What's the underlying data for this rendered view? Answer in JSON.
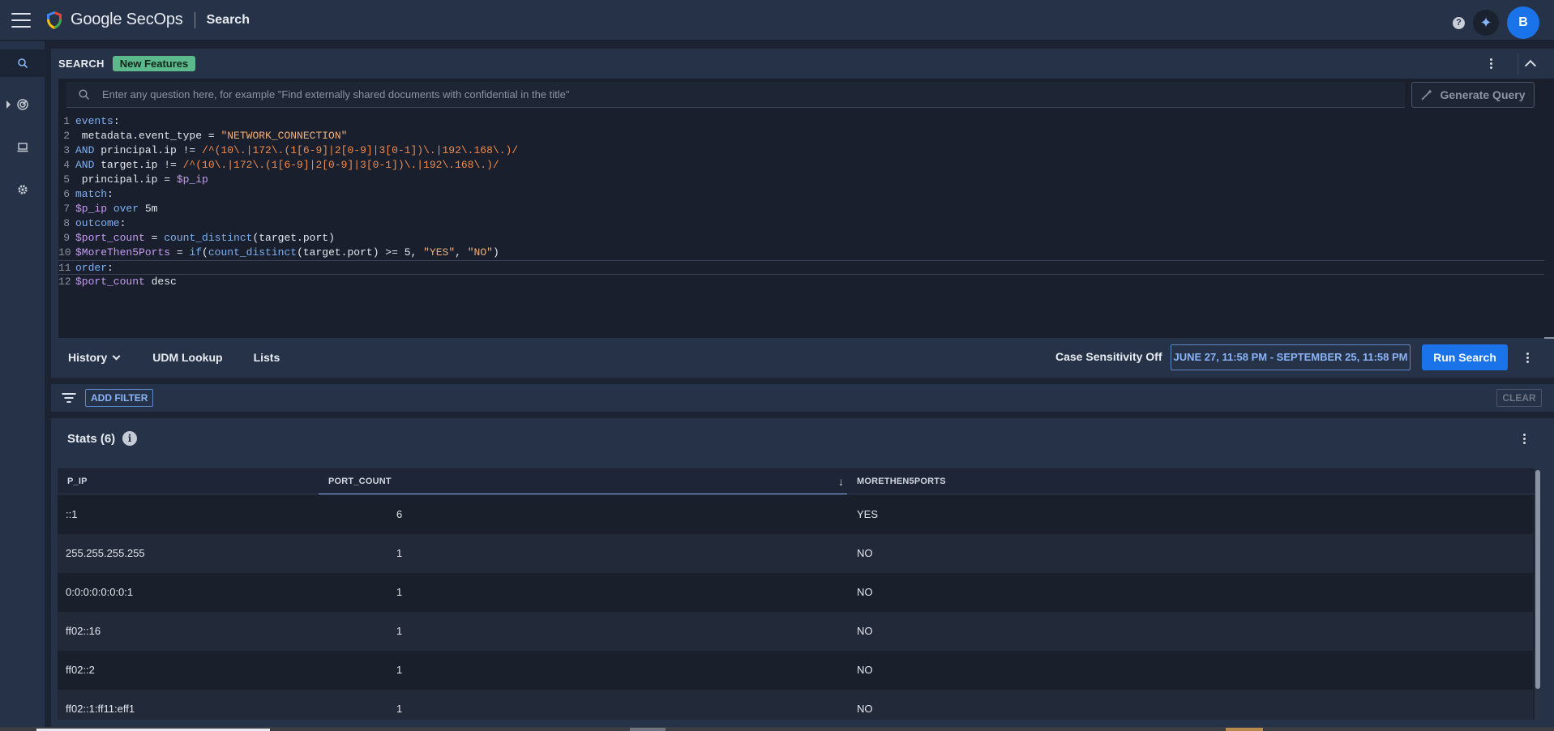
{
  "header": {
    "brand": "Google SecOps",
    "page_name": "Search",
    "help_icon": "help-icon",
    "gemini_icon": "sparkle-icon",
    "avatar_initial": "B"
  },
  "rail": {
    "items": [
      {
        "icon": "search-icon"
      },
      {
        "icon": "radar-icon"
      },
      {
        "icon": "laptop-icon"
      },
      {
        "icon": "gear-icon"
      }
    ]
  },
  "search_panel": {
    "title": "SEARCH",
    "badge": "New Features",
    "nl_placeholder": "Enter any question here, for example \"Find externally shared documents with confidential in the title\"",
    "generate_label": "Generate Query",
    "code_lines": [
      {
        "n": "1",
        "parts": [
          [
            "kw",
            "events"
          ],
          [
            "tx",
            ":"
          ]
        ]
      },
      {
        "n": "2",
        "parts": [
          [
            "tx",
            " metadata.event_type = "
          ],
          [
            "str",
            "\"NETWORK_CONNECTION\""
          ]
        ]
      },
      {
        "n": "3",
        "parts": [
          [
            "kw",
            "AND"
          ],
          [
            "tx",
            " principal.ip != "
          ],
          [
            "rx",
            "/^(10\\.|172\\.(1[6-9]|2[0-9]|3[0-1])\\.|192\\.168\\.)/"
          ]
        ]
      },
      {
        "n": "4",
        "parts": [
          [
            "kw",
            "AND"
          ],
          [
            "tx",
            " target.ip != "
          ],
          [
            "rx",
            "/^(10\\.|172\\.(1[6-9]|2[0-9]|3[0-1])\\.|192\\.168\\.)/"
          ]
        ]
      },
      {
        "n": "5",
        "parts": [
          [
            "tx",
            " principal.ip = "
          ],
          [
            "var",
            "$p_ip"
          ]
        ]
      },
      {
        "n": "6",
        "parts": [
          [
            "kw",
            "match"
          ],
          [
            "tx",
            ":"
          ]
        ]
      },
      {
        "n": "7",
        "parts": [
          [
            "var",
            "$p_ip"
          ],
          [
            "kw",
            " over"
          ],
          [
            "tx",
            " 5m"
          ]
        ]
      },
      {
        "n": "8",
        "parts": [
          [
            "kw",
            "outcome"
          ],
          [
            "tx",
            ":"
          ]
        ]
      },
      {
        "n": "9",
        "parts": [
          [
            "var",
            "$port_count"
          ],
          [
            "tx",
            " = "
          ],
          [
            "fn",
            "count_distinct"
          ],
          [
            "tx",
            "(target.port)"
          ]
        ]
      },
      {
        "n": "10",
        "parts": [
          [
            "var",
            "$MoreThen5Ports"
          ],
          [
            "tx",
            " = "
          ],
          [
            "fn",
            "if"
          ],
          [
            "tx",
            "("
          ],
          [
            "fn",
            "count_distinct"
          ],
          [
            "tx",
            "(target.port) >= 5, "
          ],
          [
            "str",
            "\"YES\""
          ],
          [
            "tx",
            ", "
          ],
          [
            "str",
            "\"NO\""
          ],
          [
            "tx",
            ")"
          ]
        ]
      },
      {
        "n": "11",
        "parts": [
          [
            "kw",
            "order"
          ],
          [
            "tx",
            ":"
          ]
        ]
      },
      {
        "n": "12",
        "parts": [
          [
            "var",
            "$port_count"
          ],
          [
            "tx",
            " desc"
          ]
        ]
      }
    ],
    "footer": {
      "history": "History",
      "udm_lookup": "UDM Lookup",
      "lists": "Lists",
      "case_sensitivity": "Case Sensitivity Off",
      "time_range": "JUNE 27, 11:58 PM - SEPTEMBER 25, 11:58 PM",
      "run_label": "Run Search"
    }
  },
  "filterbar": {
    "add_filter": "ADD FILTER",
    "clear": "CLEAR"
  },
  "stats": {
    "title": "Stats (6)",
    "info": "i",
    "columns": [
      "P_IP",
      "PORT_COUNT",
      "MORETHEN5PORTS"
    ],
    "sort_arrow": "↓",
    "rows": [
      [
        "::1",
        "6",
        "YES"
      ],
      [
        "255.255.255.255",
        "1",
        "NO"
      ],
      [
        "0:0:0:0:0:0:0:1",
        "1",
        "NO"
      ],
      [
        "ff02::16",
        "1",
        "NO"
      ],
      [
        "ff02::2",
        "1",
        "NO"
      ],
      [
        "ff02::1:ff11:eff1",
        "1",
        "NO"
      ]
    ]
  }
}
